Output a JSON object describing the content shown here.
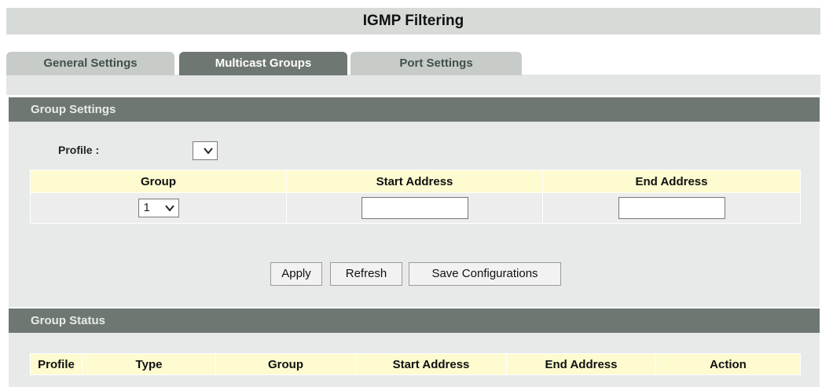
{
  "page": {
    "title": "IGMP Filtering"
  },
  "tabs": [
    {
      "label": "General Settings",
      "active": false
    },
    {
      "label": "Multicast Groups",
      "active": true
    },
    {
      "label": "Port Settings",
      "active": false
    }
  ],
  "group_settings": {
    "header": "Group Settings",
    "profile_label": "Profile :",
    "profile_value": "",
    "columns": [
      "Group",
      "Start Address",
      "End Address"
    ],
    "row": {
      "group": "1",
      "start_address": "",
      "end_address": ""
    }
  },
  "buttons": {
    "apply": "Apply",
    "refresh": "Refresh",
    "save": "Save Configurations"
  },
  "group_status": {
    "header": "Group Status",
    "columns": [
      "Profile",
      "Type",
      "Group",
      "Start Address",
      "End Address",
      "Action"
    ]
  },
  "colors": {
    "header_bg": "#6f7772",
    "table_header_bg": "#fdfbcf",
    "tab_active": "#6f7772",
    "tab_inactive": "#c8ccc9"
  }
}
